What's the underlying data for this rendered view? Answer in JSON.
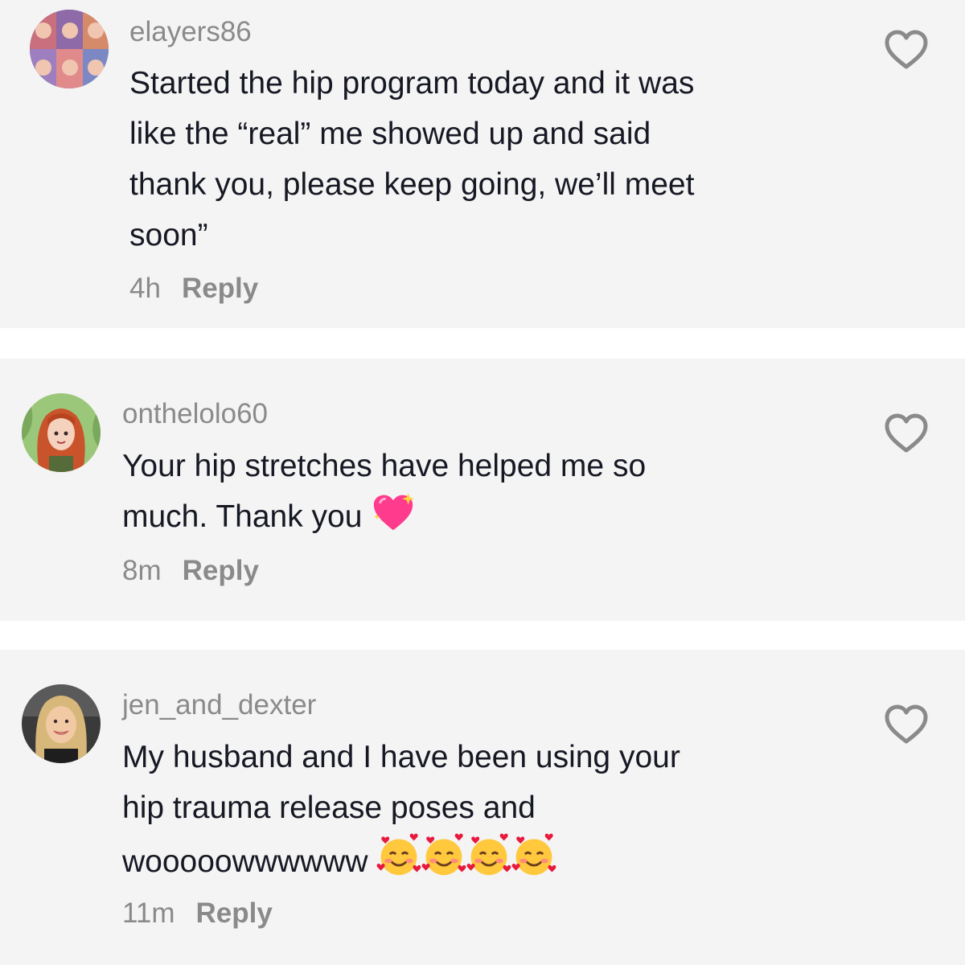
{
  "comments": [
    {
      "username": "elayers86",
      "lines": [
        "Started the hip program today and it was",
        "like the “real” me showed up and said",
        "thank you, please keep going, we’ll meet",
        "soon”"
      ],
      "time": "4h",
      "reply_label": "Reply",
      "avatar": "avatar-collage-icon"
    },
    {
      "username": "onthelolo60",
      "lines": [
        "Your hip stretches have helped me so",
        "much. Thank you"
      ],
      "emoji": "sparkling-heart-icon",
      "time": "8m",
      "reply_label": "Reply",
      "avatar": "avatar-cartoon-redhead-icon"
    },
    {
      "username": "jen_and_dexter",
      "lines": [
        "My husband and I have been using your",
        "hip trauma release poses and",
        "wooooowwwwww"
      ],
      "emoji": "smiling-face-with-hearts-icon",
      "emoji_count": 4,
      "time": "11m",
      "reply_label": "Reply",
      "avatar": "avatar-woman-photo-icon"
    }
  ],
  "colors": {
    "background": "#f4f4f4",
    "separator": "#ffffff",
    "text": "#161823",
    "muted": "#8a8a8a",
    "heart_pink": "#ff3b8d"
  }
}
